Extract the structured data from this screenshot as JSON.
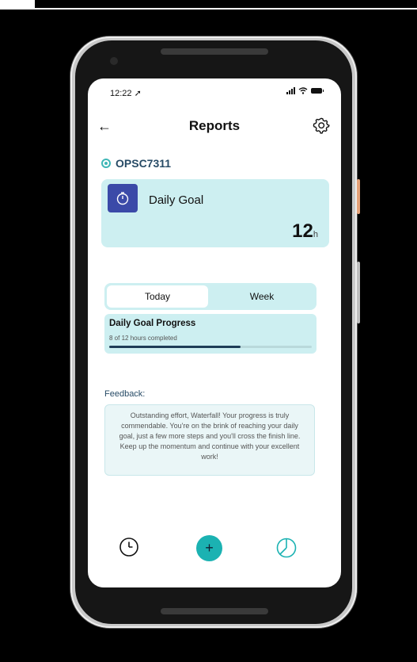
{
  "status": {
    "time": "12:22 ➚"
  },
  "header": {
    "title": "Reports",
    "back_symbol": "←"
  },
  "module": {
    "name": "OPSC7311"
  },
  "goal": {
    "label": "Daily Goal",
    "value": "12",
    "unit": "h"
  },
  "tabs": {
    "today": "Today",
    "week": "Week",
    "selected": "Today"
  },
  "progress": {
    "title": "Daily Goal Progress",
    "subtitle": "8 of 12 hours completed",
    "fraction": 0.65
  },
  "feedback": {
    "label": "Feedback:",
    "text": "Outstanding effort, Waterfall! Your progress is truly commendable. You're on the brink of reaching your daily goal, just a few more steps and you'll cross the finish line. Keep up the momentum and continue with your excellent work!"
  },
  "nav": {
    "add_symbol": "+"
  },
  "colors": {
    "accent": "#1bb2b2",
    "card": "#cdeff1",
    "goal_icon_bg": "#3b4aa8",
    "text_dark": "#274b66"
  },
  "icons": {
    "back": "arrow-left-icon",
    "settings": "gear-icon",
    "module": "target-icon",
    "goal": "stopwatch-icon",
    "nav_history": "clock-icon",
    "nav_add": "plus-icon",
    "nav_reports": "pie-chart-icon"
  }
}
